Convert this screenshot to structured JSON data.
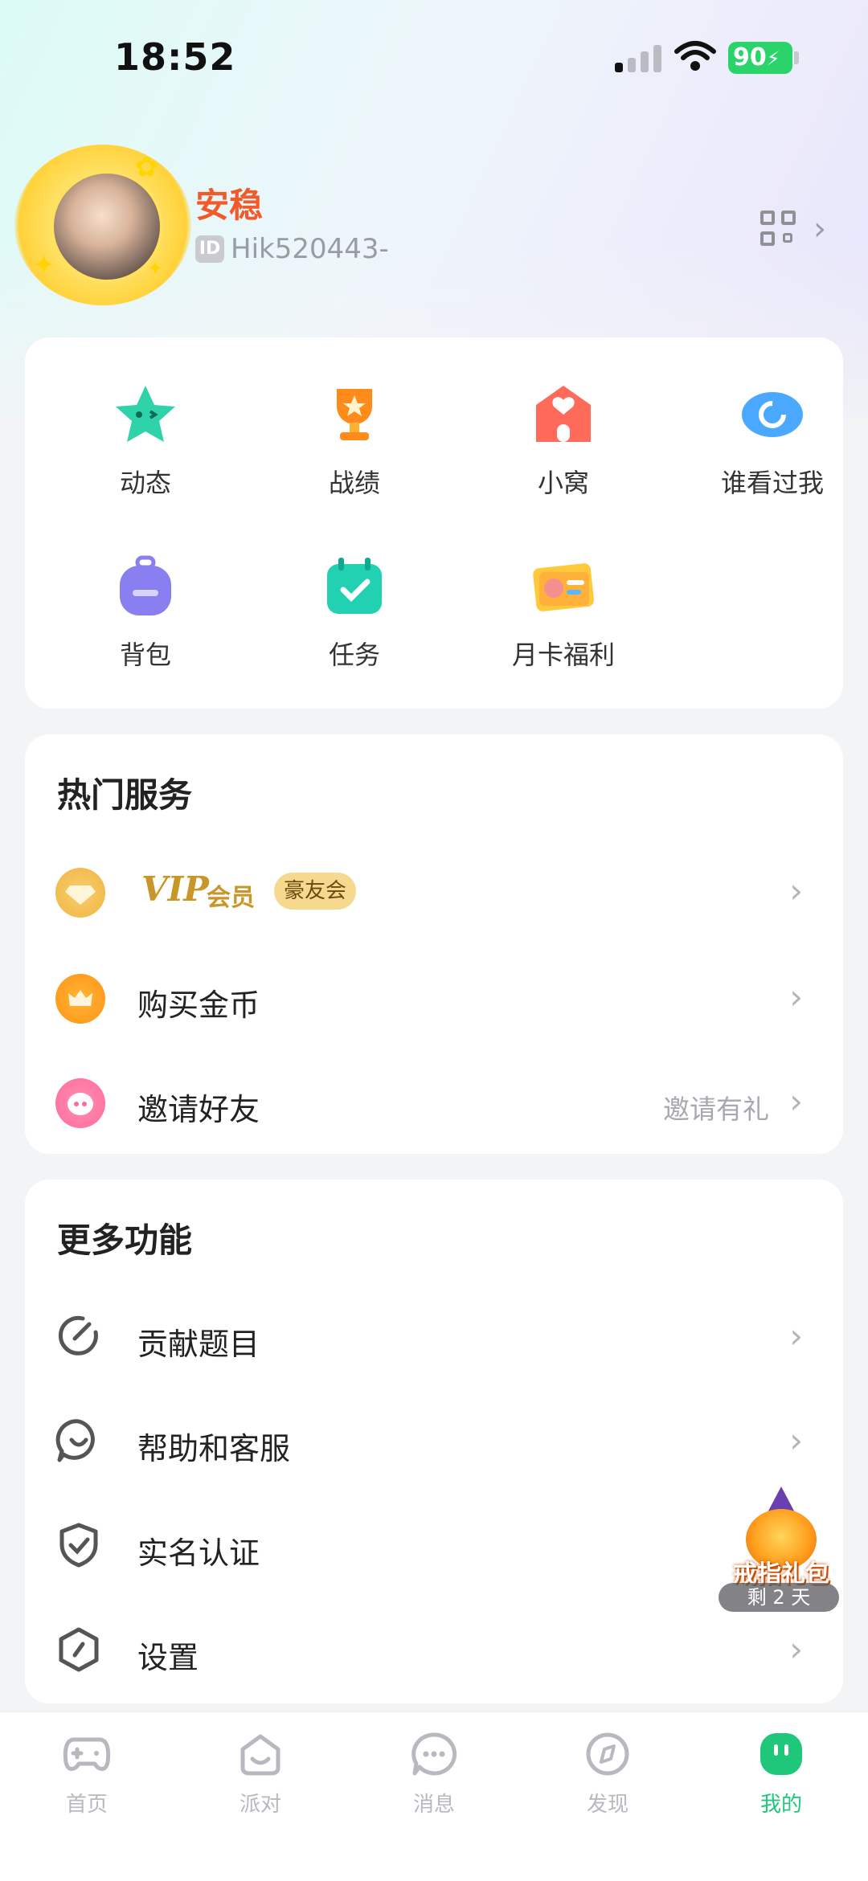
{
  "status_bar": {
    "time": "18:52",
    "battery": "90"
  },
  "profile": {
    "name": "安稳",
    "id_badge": "ID",
    "id": "Hik520443-"
  },
  "quick_grid": [
    {
      "label": "动态",
      "icon": "star-face-icon"
    },
    {
      "label": "战绩",
      "icon": "trophy-icon"
    },
    {
      "label": "小窝",
      "icon": "house-heart-icon"
    },
    {
      "label": "谁看过我",
      "icon": "eye-icon"
    },
    {
      "label": "背包",
      "icon": "backpack-icon"
    },
    {
      "label": "任务",
      "icon": "calendar-check-icon"
    },
    {
      "label": "月卡福利",
      "icon": "month-card-icon"
    }
  ],
  "hot_services": {
    "title": "热门服务",
    "vip": {
      "label": "VIP",
      "suffix": "会员",
      "badge": "豪友会"
    },
    "buy_coins": {
      "label": "购买金币"
    },
    "invite": {
      "label": "邀请好友",
      "hint": "邀请有礼"
    }
  },
  "more_features": {
    "title": "更多功能",
    "items": [
      {
        "label": "贡献题目",
        "icon": "contribute-icon"
      },
      {
        "label": "帮助和客服",
        "icon": "chat-support-icon"
      },
      {
        "label": "实名认证",
        "icon": "shield-check-icon"
      },
      {
        "label": "设置",
        "icon": "settings-icon"
      }
    ]
  },
  "promo": {
    "title": "戒指礼包",
    "sub": "剩 2 天"
  },
  "bottom_nav": [
    {
      "label": "首页",
      "icon": "gamepad-icon",
      "active": false
    },
    {
      "label": "派对",
      "icon": "party-icon",
      "active": false
    },
    {
      "label": "消息",
      "icon": "message-icon",
      "active": false
    },
    {
      "label": "发现",
      "icon": "compass-icon",
      "active": false
    },
    {
      "label": "我的",
      "icon": "me-icon",
      "active": true
    }
  ],
  "colors": {
    "accent": "#1ec77a",
    "username": "#f25a2a",
    "vip_gold": "#c9962a"
  }
}
